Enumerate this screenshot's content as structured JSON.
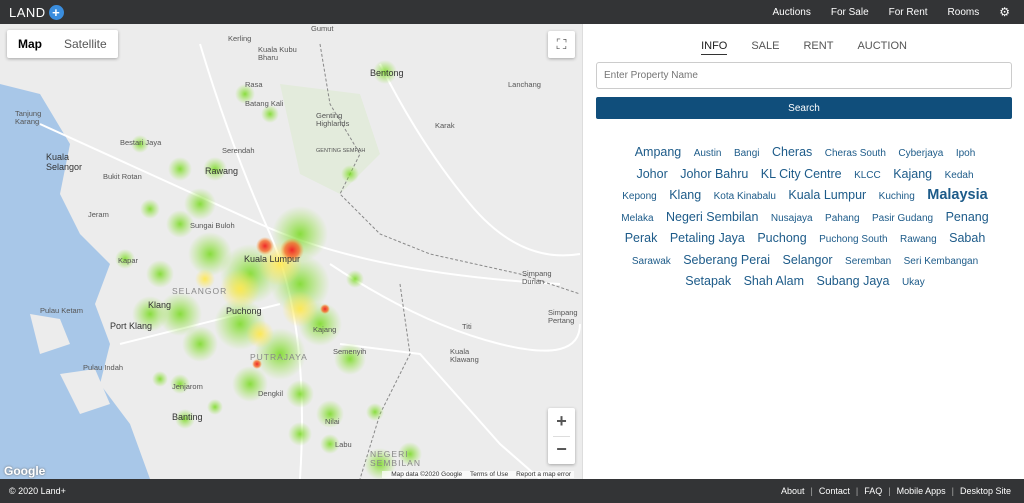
{
  "header": {
    "logo_text": "LAND",
    "logo_plus": "+",
    "nav": [
      "Auctions",
      "For Sale",
      "For Rent",
      "Rooms"
    ],
    "settings_icon": "gear-icon"
  },
  "map": {
    "type_active": "Map",
    "type_inactive": "Satellite",
    "fullscreen_icon": "fullscreen-icon",
    "zoom_in": "+",
    "zoom_out": "−",
    "google": "Google",
    "attribution": [
      "Map data ©2020 Google",
      "Terms of Use",
      "Report a map error"
    ],
    "labels": [
      "Gumut",
      "Kerling",
      "Kuala Kubu Bharu",
      "Rasa",
      "Batang Kali",
      "Bentong",
      "Lanchang",
      "Genting Highlands",
      "GENTING SEMPAH",
      "Karak",
      "Tanjung Karang",
      "Bestari Jaya",
      "Kuala Selangor",
      "Serendah",
      "Rawang",
      "Bukit Rotan",
      "Jeram",
      "Sungai Buloh",
      "Kuala Lumpur",
      "Kapar",
      "SELANGOR",
      "Klang",
      "Puchong",
      "Pulau Ketam",
      "Port Klang",
      "Kajang",
      "PUTRAJAYA",
      "Semenyih",
      "Pulau Indah",
      "Jenjarom",
      "Dengkil",
      "Banting",
      "Nilai",
      "Labu",
      "NEGERI SEMBILAN",
      "Simpang Durian",
      "Titi",
      "Kuala Klawang",
      "Simpang Pertang"
    ]
  },
  "panel": {
    "tabs": [
      "INFO",
      "SALE",
      "RENT",
      "AUCTION"
    ],
    "search_placeholder": "Enter Property Name",
    "search_button": "Search",
    "locations": [
      "Ampang",
      "Austin",
      "Bangi",
      "Cheras",
      "Cheras South",
      "Cyberjaya",
      "Ipoh",
      "Johor",
      "Johor Bahru",
      "KL City Centre",
      "KLCC",
      "Kajang",
      "Kedah",
      "Kepong",
      "Klang",
      "Kota Kinabalu",
      "Kuala Lumpur",
      "Kuching",
      "Malaysia",
      "Melaka",
      "Negeri Sembilan",
      "Nusajaya",
      "Pahang",
      "Pasir Gudang",
      "Penang",
      "Perak",
      "Petaling Jaya",
      "Puchong",
      "Puchong South",
      "Rawang",
      "Sabah",
      "Sarawak",
      "Seberang Perai",
      "Selangor",
      "Seremban",
      "Seri Kembangan",
      "Setapak",
      "Shah Alam",
      "Subang Jaya",
      "Ukay"
    ]
  },
  "footer": {
    "copyright": "© 2020 Land+",
    "links": [
      "About",
      "Contact",
      "FAQ",
      "Mobile Apps",
      "Desktop Site"
    ]
  }
}
